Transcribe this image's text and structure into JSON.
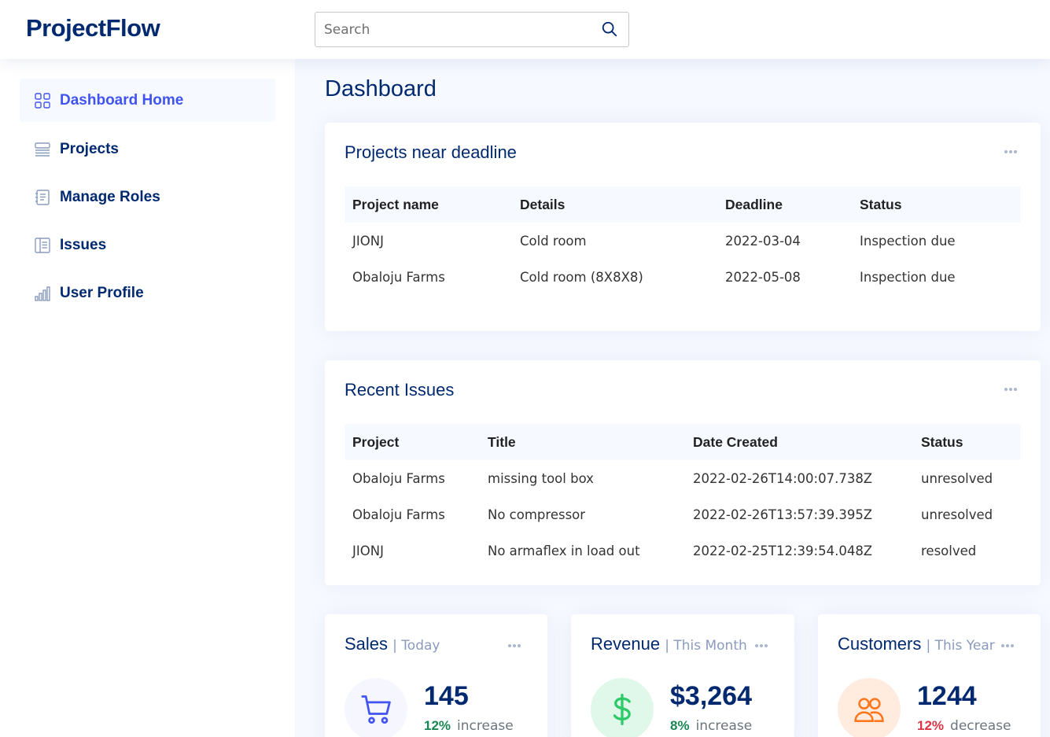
{
  "header": {
    "logo": "ProjectFlow",
    "search_placeholder": "Search"
  },
  "sidebar": {
    "items": [
      {
        "label": "Dashboard Home",
        "icon": "grid-icon",
        "active": true
      },
      {
        "label": "Projects",
        "icon": "menu-button-icon"
      },
      {
        "label": "Manage Roles",
        "icon": "journal-text-icon"
      },
      {
        "label": "Issues",
        "icon": "layout-text-icon"
      },
      {
        "label": "User Profile",
        "icon": "bar-chart-icon"
      }
    ]
  },
  "page_title": "Dashboard",
  "deadline_card": {
    "title": "Projects near deadline",
    "columns": [
      "Project name",
      "Details",
      "Deadline",
      "Status"
    ],
    "rows": [
      [
        "JIONJ",
        "Cold room",
        "2022-03-04",
        "Inspection due"
      ],
      [
        "Obaloju Farms",
        "Cold room (8X8X8)",
        "2022-05-08",
        "Inspection due"
      ]
    ]
  },
  "issues_card": {
    "title": "Recent Issues",
    "columns": [
      "Project",
      "Title",
      "Date Created",
      "Status"
    ],
    "rows": [
      [
        "Obaloju Farms",
        "missing tool box",
        "2022-02-26T14:00:07.738Z",
        "unresolved"
      ],
      [
        "Obaloju Farms",
        "No compressor",
        "2022-02-26T13:57:39.395Z",
        "unresolved"
      ],
      [
        "JIONJ",
        "No armaflex in load out",
        "2022-02-25T12:39:54.048Z",
        "resolved"
      ]
    ]
  },
  "stats": {
    "sales": {
      "title": "Sales",
      "period": "| Today",
      "value": "145",
      "pct": "12%",
      "trend": "increase",
      "icon": "cart-icon",
      "color": "#4154f1",
      "bg": "#f6f6fe",
      "pct_color": "#198754"
    },
    "revenue": {
      "title": "Revenue",
      "period": "| This Month",
      "value": "$3,264",
      "pct": "8%",
      "trend": "increase",
      "icon": "currency-dollar-icon",
      "color": "#2eca6a",
      "bg": "#e0f8e9",
      "pct_color": "#198754"
    },
    "customers": {
      "title": "Customers",
      "period": "| This Year",
      "value": "1244",
      "pct": "12%",
      "trend": "decrease",
      "icon": "people-icon",
      "color": "#ff771d",
      "bg": "#ffecdf",
      "pct_color": "#dc3545"
    }
  }
}
